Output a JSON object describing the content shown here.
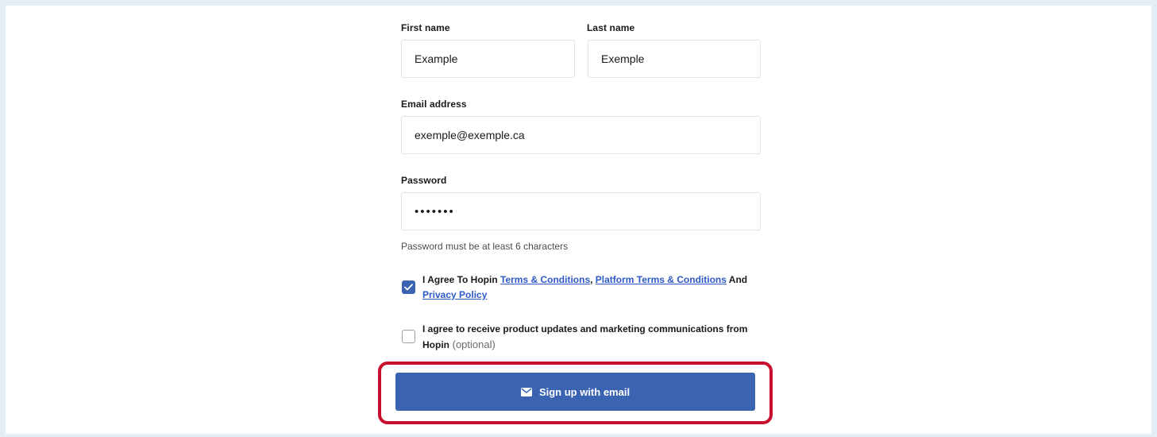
{
  "form": {
    "first_name": {
      "label": "First name",
      "value": "Example"
    },
    "last_name": {
      "label": "Last name",
      "value": "Exemple"
    },
    "email": {
      "label": "Email address",
      "value": "exemple@exemple.ca"
    },
    "password": {
      "label": "Password",
      "value": "•••••••",
      "hint": "Password must be at least 6 characters"
    },
    "terms": {
      "checked": true,
      "text_prefix": "I Agree To Hopin ",
      "link_terms": "Terms & Conditions",
      "separator": ", ",
      "link_platform_terms": "Platform Terms & Conditions",
      "text_and": " And",
      "link_privacy": "Privacy Policy"
    },
    "marketing": {
      "checked": false,
      "text": "I agree to receive product updates and marketing communications from",
      "text_brand": "Hopin",
      "optional": " (optional)"
    },
    "submit": {
      "label": "Sign up with email",
      "icon": "mail-icon"
    }
  },
  "colors": {
    "primary": "#3a64b2",
    "link": "#2d59c5",
    "highlight": "#c8102e",
    "background": "#e3edf6"
  }
}
